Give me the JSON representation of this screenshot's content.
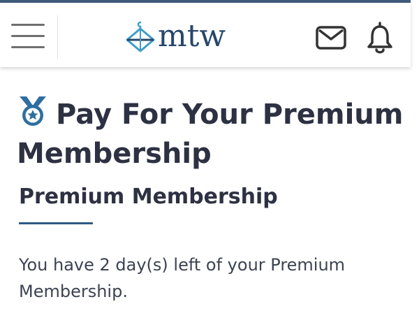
{
  "header": {
    "menu_icon": "hamburger-menu-icon",
    "logo_text": "mtw",
    "logo_icon": "hanger-diamond-icon",
    "mail_icon": "envelope-icon",
    "notifications_icon": "bell-icon",
    "colors": {
      "brand": "#27476a",
      "icon_dark": "#333333",
      "menu_gray": "#6f6f6f",
      "accent": "#3f5c7a"
    }
  },
  "page": {
    "title": "Pay For Your Premium Membership",
    "title_icon": "medal-icon",
    "section_heading": "Premium Membership",
    "message": "You have 2 day(s) left of your Premium Membership."
  }
}
